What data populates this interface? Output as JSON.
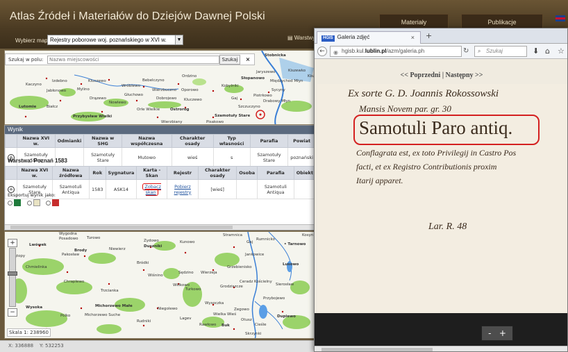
{
  "app": {
    "title": "Atlas Źródeł i Materiałów do Dziejów Dawnej Polski",
    "nav": [
      "Materiały",
      "Publikacje"
    ]
  },
  "map_select": {
    "label": "Wybierz mapę",
    "value": "Rejestry poborowe woj. poznańskiego w XVI w.",
    "layers_label": "Warstwy"
  },
  "search": {
    "label": "Szukaj w polu:",
    "placeholder": "Nazwa miejscowości",
    "button": "Szukaj",
    "close": "×"
  },
  "map_top_labels": [
    "Stobnicka",
    "Jaryszewo",
    "Kiszewko",
    "Kisz",
    "Słopanowo",
    "Międzychod Młyn",
    "Ordzino",
    "Bebelczyno",
    "Wróblewo",
    "Wierzbuczno",
    "Oporowo",
    "Kobylniki",
    "Jabłonowo",
    "Głuchowo",
    "Dobrojewo",
    "Kluczewo",
    "Piotrkowo",
    "Sycyny",
    "Kaczyno",
    "Izdebno",
    "Mylino",
    "Kluczewo",
    "Drązewo",
    "Nowlewo",
    "Gaj",
    "Orle Wielkie",
    "Ostroróg",
    "Szczuczyno",
    "Drabowy Młyn",
    "Szamotuły Stare",
    "Pisakowo",
    "Lutomie",
    "Białcz",
    "Przybysław Wielki",
    "Wierzbiany"
  ],
  "results": {
    "panel_title": "Wynik",
    "table_a": {
      "columns": [
        "",
        "Nazwa XVI w.",
        "Odmianki",
        "Nazwa w SHG",
        "Nazwa współczesna",
        "Charakter osady",
        "Typ własności",
        "Parafia",
        "Powiat"
      ],
      "rows": [
        [
          "",
          "Szamotuły Stare",
          "",
          "Szamotuły Stare",
          "Mutowo",
          "wieś",
          "s",
          "Szamotuły Stare",
          "poznański"
        ]
      ]
    },
    "layer_title": "Warstwa: Poznań 1583",
    "table_b": {
      "columns": [
        "",
        "Nazwa XVI w.",
        "Nazwa źródłowa",
        "Rok",
        "Sygnatura",
        "Karta - Skan",
        "Rejestr",
        "Charakter osady",
        "Osoba",
        "Parafia",
        "Obiekt"
      ],
      "rows": [
        [
          "",
          "Szamotuły Stare",
          "Szamotuli Antiqua",
          "1583",
          "ASK14",
          "Zobacz skan",
          "Pobierz rejestry",
          "[wieś]",
          "",
          "Szamotuli Antiqua",
          ""
        ]
      ]
    },
    "export_label": "Eksportuj wynik jako:"
  },
  "map_bottom_labels": [
    "Lwówek",
    "Brody",
    "Niewierz",
    "Duszniki",
    "Kunowo",
    "Bródki",
    "Chmielinka",
    "Sędzino",
    "Wierzeja",
    "Grzebienisko",
    "Chraplewo",
    "Trzcianka",
    "Willkowo",
    "Grodziszcze",
    "Wysoczka",
    "Zegowo",
    "Wielka Wieś",
    "Otusz",
    "Buk",
    "Rudniki",
    "Niegolewo",
    "Michorzewo Małe",
    "Michorzewo Suche",
    "Ciesle",
    "Dupiewo",
    "Tarnowo",
    "Lusowo",
    "Sierosław",
    "Stramnica",
    "Gaj",
    "Rumnicko",
    "Skrzynki",
    "Pakosław",
    "Turkowo",
    "Wygodna",
    "Posadowo",
    "Sątopy",
    "Wieckowice",
    "Brzoza",
    "Rawłowo",
    "Ceradz Kościelny",
    "Jankowice",
    "Pólko",
    "Wysoka",
    "Wiśnino",
    "Przybojewo",
    "Zydowo",
    "Kosyn"
  ],
  "zoom": {
    "plus": "+",
    "minus": "−",
    "scale_label": "Skala 1:",
    "scale_value": "238960"
  },
  "status": {
    "x_label": "X:",
    "x_value": "336888",
    "y_label": "Y:",
    "y_value": "532253"
  },
  "browser": {
    "tab_favicon": "HGIS",
    "tab_title": "Galeria zdjęć",
    "tab_close": "×",
    "new_tab": "+",
    "url_prefix": "hgisb.kul.",
    "url_host": "lublin.pl",
    "url_suffix": "/azm/galeria.ph",
    "search_placeholder": "Szukaj",
    "pager_prev": "<< Poprzedni",
    "pager_sep": "|",
    "pager_next": "Następny >>",
    "zoom_minus": "-",
    "zoom_plus": "+"
  },
  "manuscript": {
    "line1": "Ex sorte G. D. Joannis Rokossowski",
    "line2": "Mansis Novem par. gr. 30",
    "line3": "Samotuli Paro antiq.",
    "line4": "Conflagrata est, ex toto Privilegij in Castro Pos",
    "line5": "facti, et ex Registro Contributionis proxim",
    "line6": "Itarij apparet.",
    "line7": "Lar. R. 48"
  },
  "colors": {
    "header_bg": "#4a3a22",
    "accent_red": "#d42020",
    "link_blue": "#1b4f9c",
    "results_header": "#5b6a7f"
  }
}
